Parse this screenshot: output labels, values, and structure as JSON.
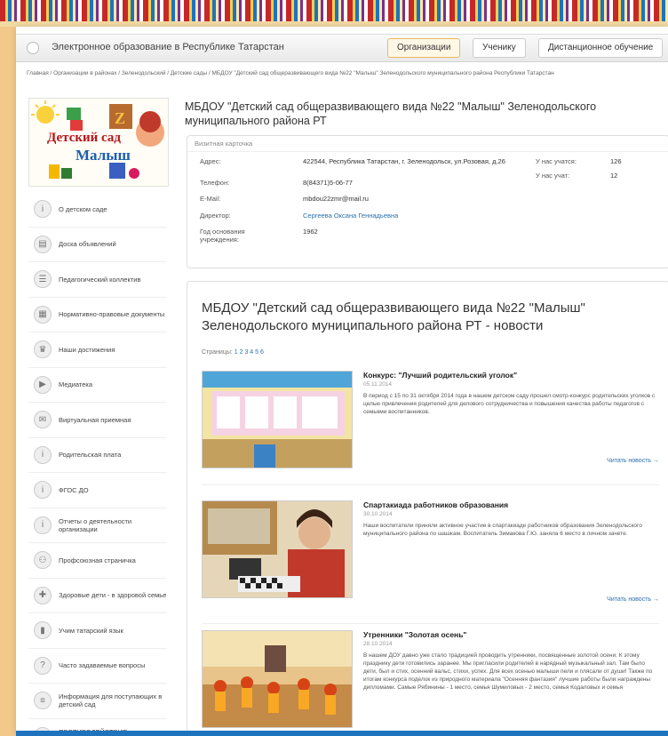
{
  "topbar": {
    "site_title": "Электронное образование в Республике Татарстан",
    "tabs": [
      "Организации",
      "Ученику",
      "Дистанционное обучение"
    ]
  },
  "breadcrumb": "Главная / Организации в районах / Зеленодольский / Детские сады / МБДОУ \"Детский сад общеразвивающего вида №22 \"Малыш\" Зеленодольского муниципального района Республики Татарстан",
  "logo": {
    "line1": "Детский сад",
    "line2": "Малыш"
  },
  "sidebar": {
    "items": [
      {
        "label": "О детском саде",
        "icon": "info-icon"
      },
      {
        "label": "Доска объявлений",
        "icon": "board-icon"
      },
      {
        "label": "Педагогический коллектив",
        "icon": "group-icon"
      },
      {
        "label": "Нормативно-правовые документы",
        "icon": "document-icon"
      },
      {
        "label": "Наши достижения",
        "icon": "trophy-icon"
      },
      {
        "label": "Медиатека",
        "icon": "media-icon"
      },
      {
        "label": "Виртуальная приемная",
        "icon": "reception-icon"
      },
      {
        "label": "Родительская плата",
        "icon": "info-icon"
      },
      {
        "label": "ФГОС ДО",
        "icon": "info-icon"
      },
      {
        "label": "Отчеты о деятельности организации",
        "icon": "info-icon"
      },
      {
        "label": "Профсоюзная страничка",
        "icon": "union-icon"
      },
      {
        "label": "Здоровые дети - в здоровой семье",
        "icon": "health-icon"
      },
      {
        "label": "Учим татарский язык",
        "icon": "book-icon"
      },
      {
        "label": "Часто задаваемые вопросы",
        "icon": "question-icon"
      },
      {
        "label": "Информация для поступающих в детский сад",
        "icon": "list-icon"
      },
      {
        "label": "ПРОТИВОДЕЙСТВИЕ КОРРУПЦИИ",
        "icon": "info-icon"
      }
    ]
  },
  "org_title": "МБДОУ \"Детский сад общеразвивающего вида №22 \"Малыш\" Зеленодольского муниципального района РТ",
  "card": {
    "header": "Визитная карточка",
    "rows": [
      {
        "label": "Адрес:",
        "value": "422544, Республика Татарстан, г. Зеленодольск, ул.Розовая, д.26"
      },
      {
        "label": "Телефон:",
        "value": "8(84371)5-06-77"
      },
      {
        "label": "E-Mail:",
        "value": "mbdou22zmr@mail.ru"
      },
      {
        "label": "Директор:",
        "value": "Сергеева Оксана Геннадьевна"
      },
      {
        "label": "Год основания учреждения:",
        "value": "1962"
      }
    ],
    "stats": [
      {
        "label": "У нас учатся:",
        "value": "126"
      },
      {
        "label": "У нас учат:",
        "value": "12"
      }
    ]
  },
  "news": {
    "title": "МБДОУ \"Детский сад общеразвивающего вида №22 \"Малыш\" Зеленодольского муниципального района РТ - новости",
    "pages_label": "Страницы:",
    "pages": "1 2 3 4 5 6",
    "read_more": "Читать новость →",
    "items": [
      {
        "title": "Конкурс: \"Лучший родительский уголок\"",
        "date": "05.11.2014",
        "text": "В период с 15 по 31 октября 2014 года в нашем детском саду прошел смотр-конкурс родительских уголков с целью привлечения родителей для делового сотрудничества и повышения качества работы педагогов с семьями воспитанников."
      },
      {
        "title": "Спартакиада работников образования",
        "date": "30.10.2014",
        "text": "Наши воспитатели приняли активное участие в спартакиаде работников образования Зеленодольского муниципального района по шашкам. Воспитатель Зимакова Г.Ю. заняла 6 место в личном зачете."
      },
      {
        "title": "Утренники \"Золотая осень\"",
        "date": "28.10.2014",
        "text": "В нашем ДОУ давно уже стало традицией проводить утренники, посвященные золотой осени. К этому празднику дети готовились заранее. Мы пригласили родителей в нарядный музыкальный зал. Там было дети, был и стих, осенний вальс, стихи, успех. Для всех осенью малыши пели и плясали от души! Также по итогам конкурса поделок из природного материала \"Осенняя фантазия\" лучшие работы были награждены дипломами. Самые Рябинины - 1 место, семья Шумиловых - 2 место, семья Кодаловых и семья"
      }
    ]
  }
}
